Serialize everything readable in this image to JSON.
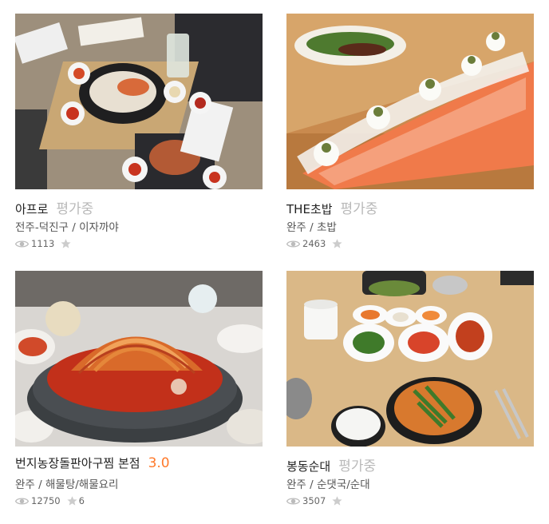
{
  "restaurants": [
    {
      "name": "아프로",
      "rating": "평가중",
      "rating_type": "pending",
      "location": "전주-덕진구",
      "category": "이자까야",
      "views": "1113",
      "reviews": "",
      "photo_desc": "izakaya-table-icon"
    },
    {
      "name": "THE초밥",
      "rating": "평가중",
      "rating_type": "pending",
      "location": "완주",
      "category": "초밥",
      "views": "2463",
      "reviews": "",
      "photo_desc": "salmon-sushi-icon"
    },
    {
      "name": "번지농장돌판아구찜 본점",
      "rating": "3.0",
      "rating_type": "score",
      "location": "완주",
      "category": "해물탕/해물요리",
      "views": "12750",
      "reviews": "6",
      "photo_desc": "spicy-monkfish-icon"
    },
    {
      "name": "봉동순대",
      "rating": "평가중",
      "rating_type": "pending",
      "location": "완주",
      "category": "순댓국/순대",
      "views": "3507",
      "reviews": "",
      "photo_desc": "sundae-soup-icon"
    }
  ],
  "separator": " / ",
  "colors": {
    "rating_pending": "#b9b9b9",
    "rating_score": "#ff792a",
    "meta_text": "#555555",
    "icon_gray": "#c4c4c4"
  }
}
